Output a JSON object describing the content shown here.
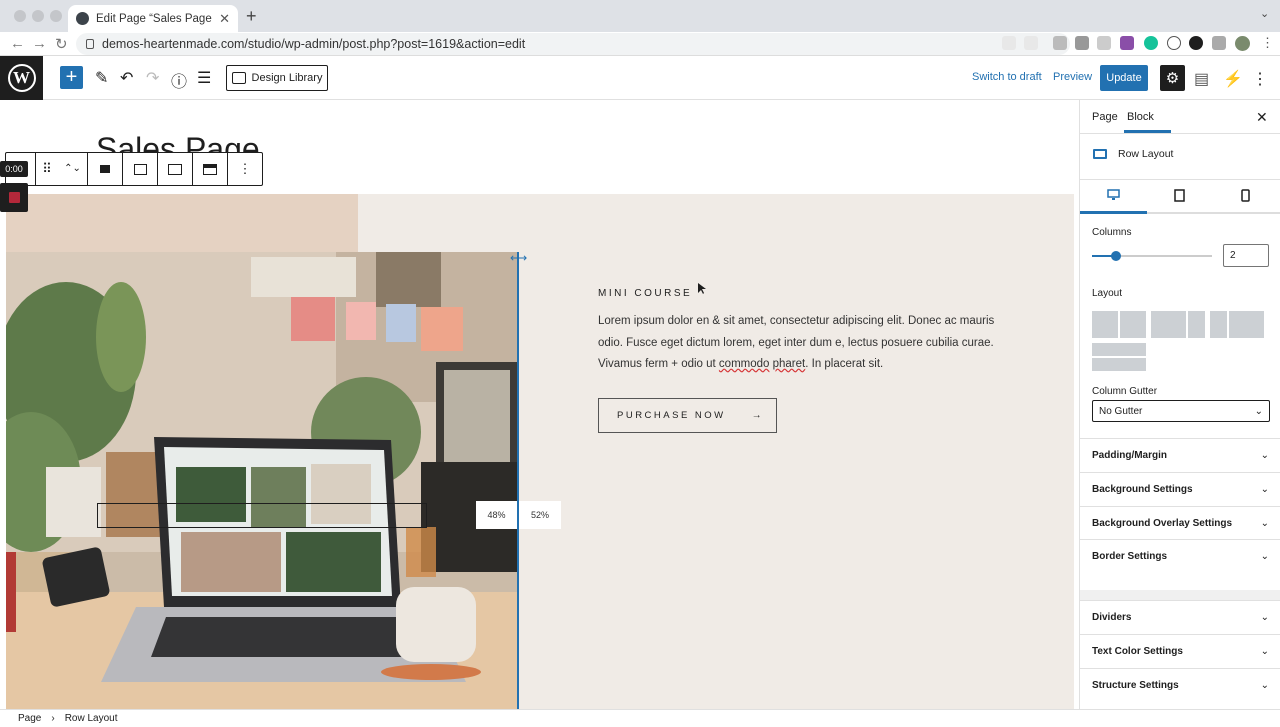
{
  "browser": {
    "tab_title": "Edit Page “Sales Page” ‹ studio",
    "tab_close": "✕",
    "new_tab": "+",
    "tab_menu": "⌄",
    "url": "demos-heartenmade.com/studio/wp-admin/post.php?post=1619&action=edit",
    "nav": {
      "back": "←",
      "forward": "→",
      "reload": "↻"
    },
    "extensions": [
      "share-icon",
      "star-icon",
      "camera-icon",
      "extension-icon",
      "app-icon",
      "badge-icon",
      "grammarly-icon",
      "c-icon",
      "circle-icon",
      "puzzle-icon",
      "profile-icon",
      "more-icon"
    ]
  },
  "wp_toolbar": {
    "logo": "W",
    "add": "+",
    "design_library": "Design Library",
    "switch_draft": "Switch to draft",
    "preview": "Preview",
    "update": "Update",
    "settings": "⚙",
    "icons": {
      "edit": "✎",
      "undo": "↶",
      "redo": "↷",
      "info": "ⓘ",
      "list": "☰",
      "panel": "▤",
      "kadence": "⚡",
      "more": "⋮"
    }
  },
  "canvas": {
    "page_title": "Sales Page",
    "eyebrow": "MINI COURSE",
    "body_parts": [
      "Lorem ipsum dolor en & sit amet, consectetur adipiscing elit. Donec ac mauris odio. Fusce eget dictum lorem, eget inter dum e, lectus posuere cubilia curae. Vivamus ferm + odio ut ",
      "commodo",
      " ",
      "pharet",
      ". In placerat sit."
    ],
    "button_label": "PURCHASE NOW",
    "button_arrow": "→",
    "pct_left": "48%",
    "pct_right": "52%",
    "resize_arrow": "⟷",
    "block_toolbar": {
      "drag": "⠿",
      "move": "⌃⌄",
      "more": "⋮"
    }
  },
  "recorder": {
    "time": "0:00"
  },
  "sidebar": {
    "tabs": {
      "page": "Page",
      "block": "Block"
    },
    "close": "✕",
    "block_name": "Row Layout",
    "device_icons": {
      "desktop": "🖥",
      "tablet": "▭",
      "mobile": "▯"
    },
    "columns_label": "Columns",
    "columns_value": "2",
    "columns_fraction": 0.2,
    "layout_label": "Layout",
    "gutter_label": "Column Gutter",
    "gutter_value": "No Gutter",
    "panels": [
      "Padding/Margin",
      "Background Settings",
      "Background Overlay Settings",
      "Border Settings"
    ],
    "panels2": [
      "Dividers",
      "Text Color Settings",
      "Structure Settings"
    ],
    "chev": "⌄"
  },
  "footer": {
    "crumb1": "Page",
    "sep": "›",
    "crumb2": "Row Layout"
  },
  "colors": {
    "accent": "#2271b1",
    "beige": "#f0ebe6",
    "tan": "#e5d2c2",
    "dark": "#1e1e1e"
  }
}
